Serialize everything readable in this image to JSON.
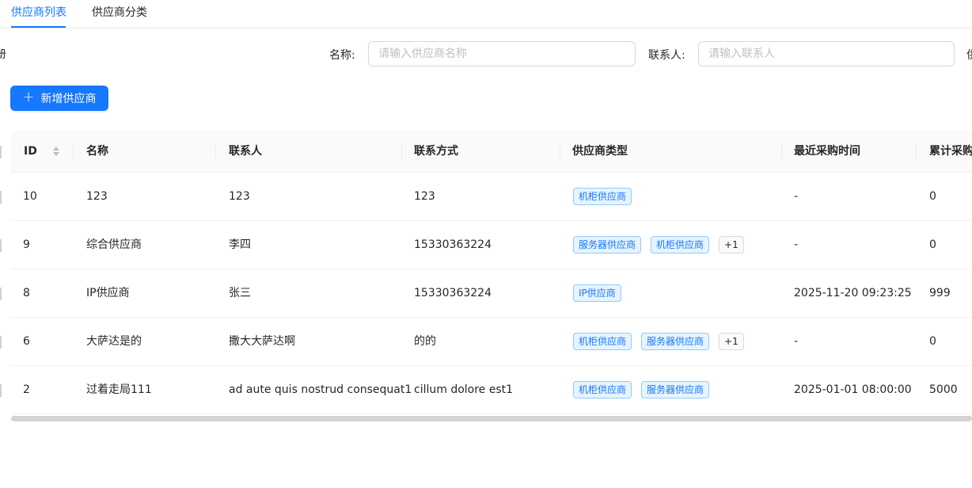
{
  "tabs": [
    {
      "label": "供应商列表",
      "active": true
    },
    {
      "label": "供应商分类",
      "active": false
    }
  ],
  "left_edge_char": "册",
  "filters": {
    "name_label": "名称:",
    "name_placeholder": "请输入供应商名称",
    "contact_label": "联系人:",
    "contact_placeholder": "请输入联系人",
    "next_label_partial": "供"
  },
  "add_button": {
    "icon": "plus-icon",
    "label": "新增供应商"
  },
  "table": {
    "columns": [
      "ID",
      "名称",
      "联系人",
      "联系方式",
      "供应商类型",
      "最近采购时间",
      "累计采购"
    ],
    "rows": [
      {
        "id": "10",
        "name": "123",
        "contact": "123",
        "phone": "123",
        "types": [
          "机柜供应商"
        ],
        "more": "",
        "last_time": "-",
        "total": "0"
      },
      {
        "id": "9",
        "name": "综合供应商",
        "contact": "李四",
        "phone": "15330363224",
        "types": [
          "服务器供应商",
          "机柜供应商"
        ],
        "more": "+1",
        "last_time": "-",
        "total": "0"
      },
      {
        "id": "8",
        "name": "IP供应商",
        "contact": "张三",
        "phone": "15330363224",
        "types": [
          "IP供应商"
        ],
        "more": "",
        "last_time": "2025-11-20 09:23:25",
        "total": "999"
      },
      {
        "id": "6",
        "name": "大萨达是的",
        "contact": "撒大大萨达啊",
        "phone": "的的",
        "types": [
          "机柜供应商",
          "服务器供应商"
        ],
        "more": "+1",
        "last_time": "-",
        "total": "0"
      },
      {
        "id": "2",
        "name": "过着走局111",
        "contact": "ad aute quis nostrud consequat1",
        "phone": "cillum dolore est1",
        "types": [
          "机柜供应商",
          "服务器供应商"
        ],
        "more": "",
        "last_time": "2025-01-01 08:00:00",
        "total": "5000"
      }
    ]
  },
  "colors": {
    "accent": "#1677ff",
    "tag_bg": "#e6f4ff",
    "tag_border": "#91caff"
  }
}
